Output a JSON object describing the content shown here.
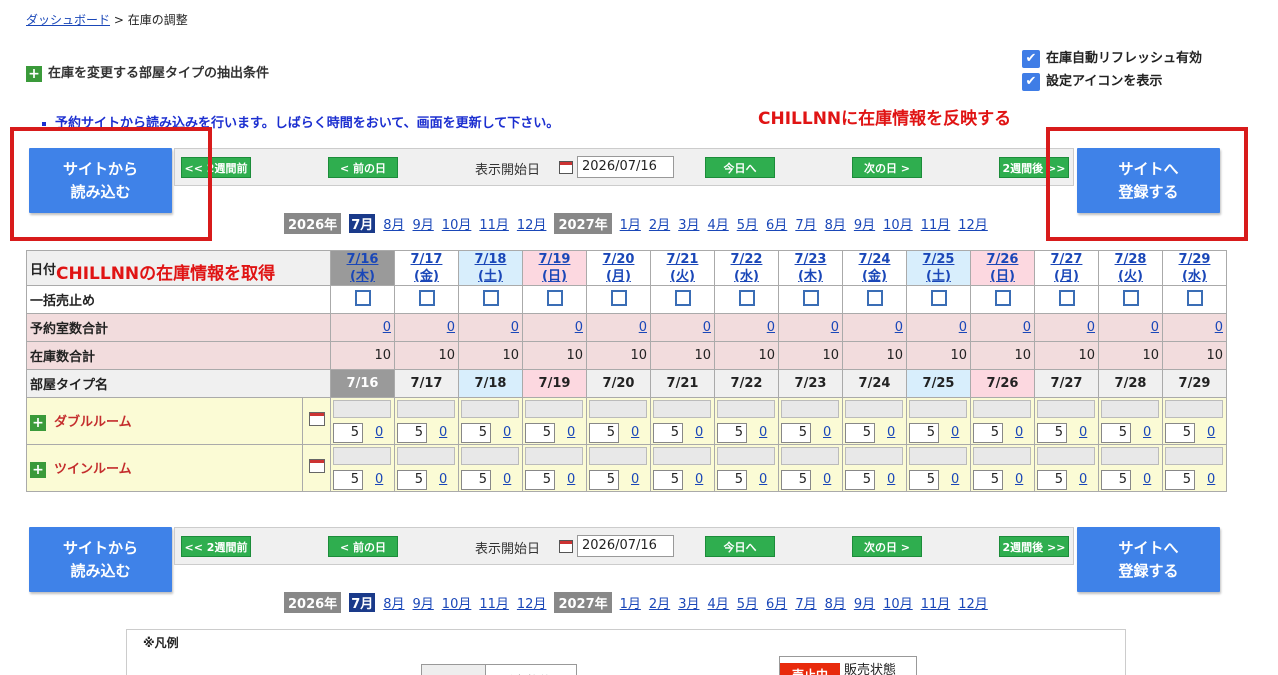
{
  "breadcrumb": {
    "home": "ダッシュボード",
    "sep": ">",
    "current": "在庫の調整"
  },
  "filter": {
    "title": "在庫を変更する部屋タイプの抽出条件"
  },
  "options": [
    {
      "label": "在庫自動リフレッシュ有効",
      "checked": true
    },
    {
      "label": "設定アイコンを表示",
      "checked": true
    }
  ],
  "notice": "予約サイトから読み込みを行います。しばらく時間をおいて、画面を更新して下さい。",
  "annotations": {
    "reflect": "CHILLNNに在庫情報を反映する",
    "fetch": "CHILLNNの在庫情報を取得"
  },
  "buttons": {
    "load_line1": "サイトから",
    "load_line2": "読み込む",
    "reg_line1": "サイトへ",
    "reg_line2": "登録する"
  },
  "nav": {
    "prev2w": "<< 2週間前",
    "prev_day": "< 前の日",
    "start_label": "表示開始日",
    "start_date": "2026/07/16",
    "today": "今日へ",
    "next_day": "次の日 >",
    "next2w": "2週間後 >>"
  },
  "months": {
    "y1": "2026年",
    "m2026": [
      "7月",
      "8月",
      "9月",
      "10月",
      "11月",
      "12月"
    ],
    "y2": "2027年",
    "m2027": [
      "1月",
      "2月",
      "3月",
      "4月",
      "5月",
      "6月",
      "7月",
      "8月",
      "9月",
      "10月",
      "11月",
      "12月"
    ]
  },
  "grid": {
    "date_header": "日付",
    "row_labels": {
      "stop": "一括売止め",
      "reserved": "予約室数合計",
      "stock": "在庫数合計",
      "roomtype": "部屋タイプ名"
    },
    "days": [
      {
        "date": "7/16",
        "dow": "(木)",
        "kind": "sel"
      },
      {
        "date": "7/17",
        "dow": "(金)",
        "kind": ""
      },
      {
        "date": "7/18",
        "dow": "(土)",
        "kind": "sat"
      },
      {
        "date": "7/19",
        "dow": "(日)",
        "kind": "sun"
      },
      {
        "date": "7/20",
        "dow": "(月)",
        "kind": ""
      },
      {
        "date": "7/21",
        "dow": "(火)",
        "kind": ""
      },
      {
        "date": "7/22",
        "dow": "(水)",
        "kind": ""
      },
      {
        "date": "7/23",
        "dow": "(木)",
        "kind": ""
      },
      {
        "date": "7/24",
        "dow": "(金)",
        "kind": ""
      },
      {
        "date": "7/25",
        "dow": "(土)",
        "kind": "sat"
      },
      {
        "date": "7/26",
        "dow": "(日)",
        "kind": "sun"
      },
      {
        "date": "7/27",
        "dow": "(月)",
        "kind": ""
      },
      {
        "date": "7/28",
        "dow": "(火)",
        "kind": ""
      },
      {
        "date": "7/29",
        "dow": "(水)",
        "kind": ""
      }
    ],
    "reserved_value": "0",
    "stock_value": "10",
    "rooms": [
      {
        "name": "ダブルルーム",
        "stock": "5",
        "reserved": "0"
      },
      {
        "name": "ツインルーム",
        "stock": "5",
        "reserved": "0"
      }
    ]
  },
  "legend": {
    "title": "※凡例",
    "sales_status": "販売状態",
    "stopped": "売止中"
  }
}
